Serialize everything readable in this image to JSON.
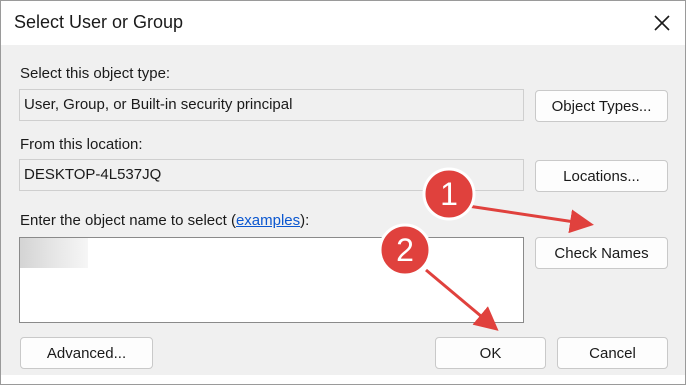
{
  "window": {
    "title": "Select User or Group"
  },
  "object_type": {
    "label": "Select this object type:",
    "value": "User, Group, or Built-in security principal",
    "button": "Object Types..."
  },
  "location": {
    "label": "From this location:",
    "value": "DESKTOP-4L537JQ",
    "button": "Locations..."
  },
  "object_name": {
    "label_prefix": "Enter the object name to select (",
    "link": "examples",
    "label_suffix": "):",
    "check_button": "Check Names"
  },
  "buttons": {
    "advanced": "Advanced...",
    "ok": "OK",
    "cancel": "Cancel"
  },
  "callouts": [
    {
      "number": "1"
    },
    {
      "number": "2"
    }
  ],
  "colors": {
    "callout": "#e0413d",
    "link": "#0b57d0"
  }
}
